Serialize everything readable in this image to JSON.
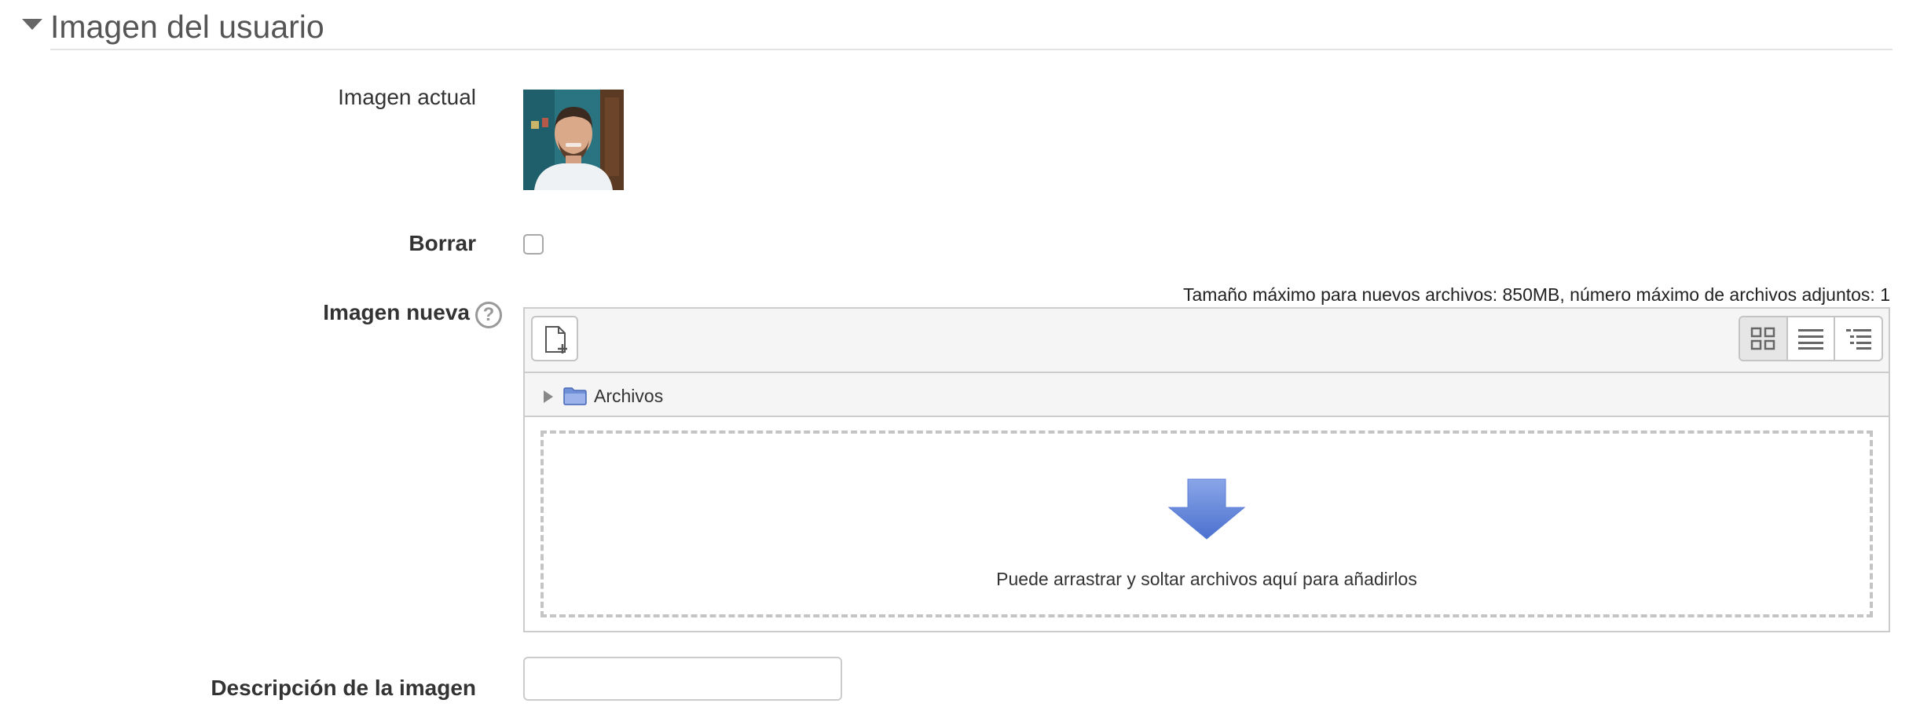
{
  "section": {
    "title": "Imagen del usuario"
  },
  "fields": {
    "current_image_label": "Imagen actual",
    "delete_label": "Borrar",
    "delete_checked": false,
    "new_image_label": "Imagen nueva",
    "help_symbol": "?",
    "description_label": "Descripción de la imagen",
    "description_value": ""
  },
  "filemanager": {
    "max_note": "Tamaño máximo para nuevos archivos: 850MB, número máximo de archivos adjuntos: 1",
    "path_root": "Archivos",
    "drop_message": "Puede arrastrar y soltar archivos aquí para añadirlos",
    "view_modes": [
      "icons-view-icon",
      "list-view-icon",
      "tree-view-icon"
    ],
    "active_view": "icons-view-icon"
  },
  "colors": {
    "folder": "#6f8fd6",
    "drop_arrow": "#5b7fd4",
    "border": "#cccccc",
    "toolbar_bg": "#f5f5f5"
  }
}
